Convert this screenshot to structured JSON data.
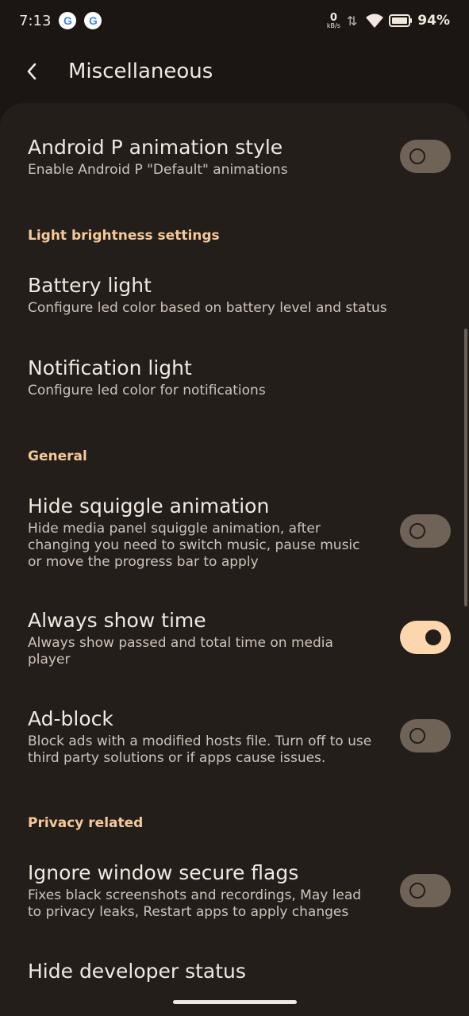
{
  "status_bar": {
    "time": "7:13",
    "notification_icons": [
      "G",
      "G"
    ],
    "net_speed_value": "0",
    "net_speed_unit": "kB/s",
    "battery_percent": "94%"
  },
  "app_bar": {
    "title": "Miscellaneous"
  },
  "settings": {
    "android_p": {
      "title": "Android P animation style",
      "summary": "Enable Android P \"Default\" animations",
      "enabled": false
    },
    "header_light": "Light brightness settings",
    "battery_light": {
      "title": "Battery light",
      "summary": "Configure led color based on battery level and status"
    },
    "notification_light": {
      "title": "Notification light",
      "summary": "Configure led color for notifications"
    },
    "header_general": "General",
    "hide_squiggle": {
      "title": "Hide squiggle animation",
      "summary_lines": [
        "Hide media panel squiggle animation, after",
        "changing you need to switch music, pause music",
        "or move the progress bar to apply"
      ],
      "enabled": false
    },
    "always_show_time": {
      "title": "Always show time",
      "summary_lines": [
        "Always show passed and total time on media",
        "player"
      ],
      "enabled": true
    },
    "ad_block": {
      "title": "Ad-block",
      "summary_lines": [
        "Block ads with a modified hosts file. Turn off to use",
        "third party solutions or if apps cause issues."
      ],
      "enabled": false
    },
    "header_privacy": "Privacy related",
    "ignore_secure": {
      "title": "Ignore window secure flags",
      "summary_lines": [
        "Fixes black screenshots and recordings, May lead",
        "to privacy leaks, Restart apps to apply changes"
      ],
      "enabled": false
    },
    "hide_dev_status": {
      "title": "Hide developer status"
    }
  }
}
